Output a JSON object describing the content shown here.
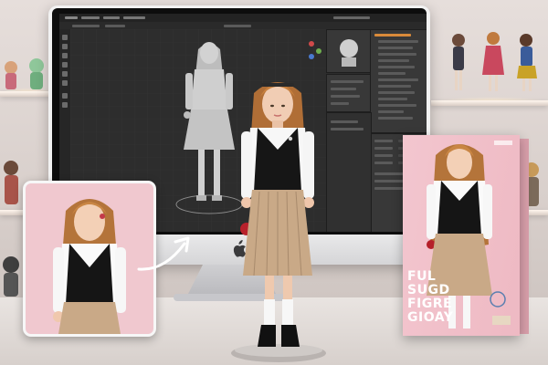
{
  "scene": {
    "description_items": [],
    "box": {
      "title_lines": [
        "FUL",
        "SUGD",
        "FIGRE",
        "GIOAY"
      ]
    },
    "monitor": {
      "logo": "apple-logo"
    }
  },
  "colors": {
    "box_pink": "#f0bcc6",
    "inset_pink": "#f0c8cf",
    "viewport_gray": "#2d2d2d",
    "selection_orange": "#d98a3a"
  }
}
